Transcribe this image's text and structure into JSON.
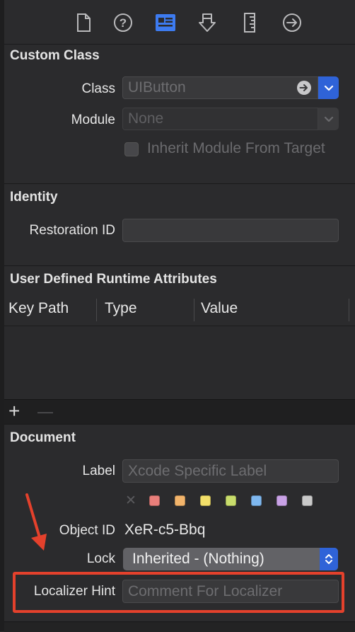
{
  "toolbar": {
    "icons": [
      "file-icon",
      "help-icon",
      "identity-inspector-icon",
      "attributes-inspector-icon",
      "size-inspector-icon",
      "connections-inspector-icon"
    ],
    "active_index": 2,
    "accent": "#3d7bf0"
  },
  "custom_class": {
    "title": "Custom Class",
    "class_label": "Class",
    "class_placeholder": "UIButton",
    "module_label": "Module",
    "module_placeholder": "None",
    "inherit_label": "Inherit Module From Target",
    "inherit_checked": false
  },
  "identity": {
    "title": "Identity",
    "restoration_label": "Restoration ID",
    "restoration_value": ""
  },
  "runtime_attributes": {
    "title": "User Defined Runtime Attributes",
    "columns": [
      "Key Path",
      "Type",
      "Value"
    ],
    "rows": [],
    "add_symbol": "+",
    "remove_symbol": "—"
  },
  "document": {
    "title": "Document",
    "label_label": "Label",
    "label_placeholder": "Xcode Specific Label",
    "clear_symbol": "✕",
    "swatch_colors": [
      "#e97f7b",
      "#f2b46b",
      "#f3e06a",
      "#c8dc6b",
      "#7fb8ef",
      "#c9a2e6",
      "#c9c9c9"
    ],
    "object_id_label": "Object ID",
    "object_id_value": "XeR-c5-Bbq",
    "lock_label": "Lock",
    "lock_value": "Inherited - (Nothing)",
    "localizer_label": "Localizer Hint",
    "localizer_placeholder": "Comment For Localizer"
  },
  "annotation": {
    "color": "#e4412c"
  }
}
